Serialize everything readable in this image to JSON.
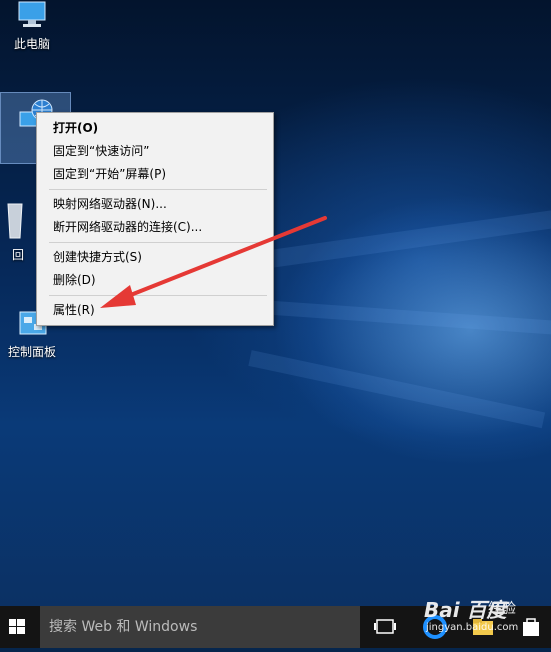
{
  "desktop": {
    "icons": [
      {
        "label": "此电脑"
      },
      {
        "label": ""
      },
      {
        "label": "回"
      },
      {
        "label": "控制面板"
      }
    ]
  },
  "context_menu": {
    "items": [
      {
        "label": "打开(O)"
      },
      {
        "label": "固定到“快速访问”"
      },
      {
        "label": "固定到“开始”屏幕(P)"
      },
      {
        "label": "映射网络驱动器(N)..."
      },
      {
        "label": "断开网络驱动器的连接(C)..."
      },
      {
        "label": "创建快捷方式(S)"
      },
      {
        "label": "删除(D)"
      },
      {
        "label": "属性(R)"
      }
    ]
  },
  "taskbar": {
    "search_placeholder": "搜索 Web 和 Windows"
  },
  "watermark": {
    "brand": "Bai 百度",
    "chinese": "经验",
    "url": "jingyan.baidu.com"
  },
  "colors": {
    "annotation_arrow": "#e53935",
    "taskbar": "#141414",
    "search_box": "#3b3b3b"
  }
}
